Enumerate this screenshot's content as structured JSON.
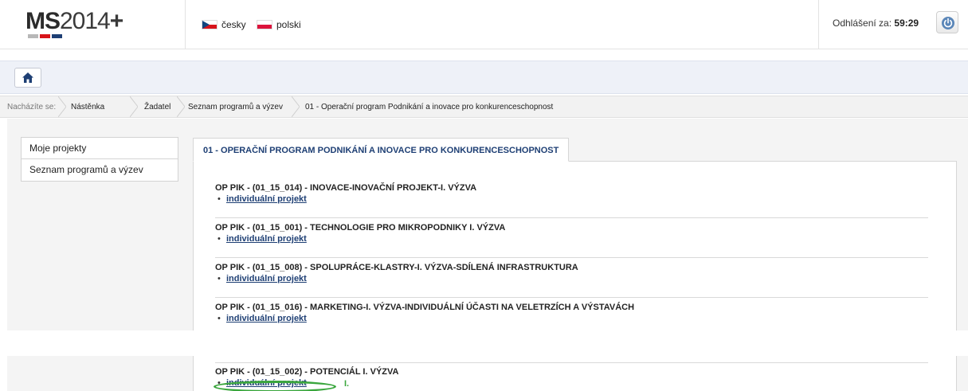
{
  "header": {
    "logo_bold": "MS",
    "logo_rest": "2014",
    "logo_plus": "+",
    "languages": [
      {
        "label": "česky",
        "flag": "cz-flag-icon"
      },
      {
        "label": "polski",
        "flag": "pl-flag-icon"
      }
    ],
    "logout_label": "Odhlášení za:",
    "logout_time": "59:29"
  },
  "breadcrumb": {
    "prefix": "Nacházíte se:",
    "items": [
      "Nástěnka",
      "Žadatel",
      "Seznam programů a výzev",
      "01 - Operační program Podnikání a inovace pro konkurenceschopnost"
    ]
  },
  "sidebar": {
    "items": [
      {
        "label": "Moje projekty"
      },
      {
        "label": "Seznam programů a výzev"
      }
    ]
  },
  "main": {
    "tab_label": "01 - OPERAČNÍ PROGRAM PODNIKÁNÍ A INOVACE PRO KONKURENCESCHOPNOST",
    "calls": [
      {
        "title": "OP PIK - (01_15_014) - INOVACE-INOVAČNÍ PROJEKT-I. VÝZVA",
        "link": "individuální projekt"
      },
      {
        "title": "OP PIK - (01_15_001) - TECHNOLOGIE PRO MIKROPODNIKY I. VÝZVA",
        "link": "individuální projekt"
      },
      {
        "title": "OP PIK - (01_15_008) - SPOLUPRÁCE-KLASTRY-I. VÝZVA-SDÍLENÁ INFRASTRUKTURA",
        "link": "individuální projekt"
      },
      {
        "title": "OP PIK - (01_15_016) - MARKETING-I. VÝZVA-INDIVIDUÁLNÍ ÚČASTI NA VELETRZÍCH A VÝSTAVÁCH",
        "link": "individuální projekt"
      },
      {
        "title": "OP PIK - (01_15_002) - POTENCIÁL I. VÝZVA",
        "link": "individuální projekt"
      }
    ],
    "annotation_label": "I."
  },
  "colors": {
    "accent": "#1e3f74",
    "highlight": "#3aa63d"
  }
}
